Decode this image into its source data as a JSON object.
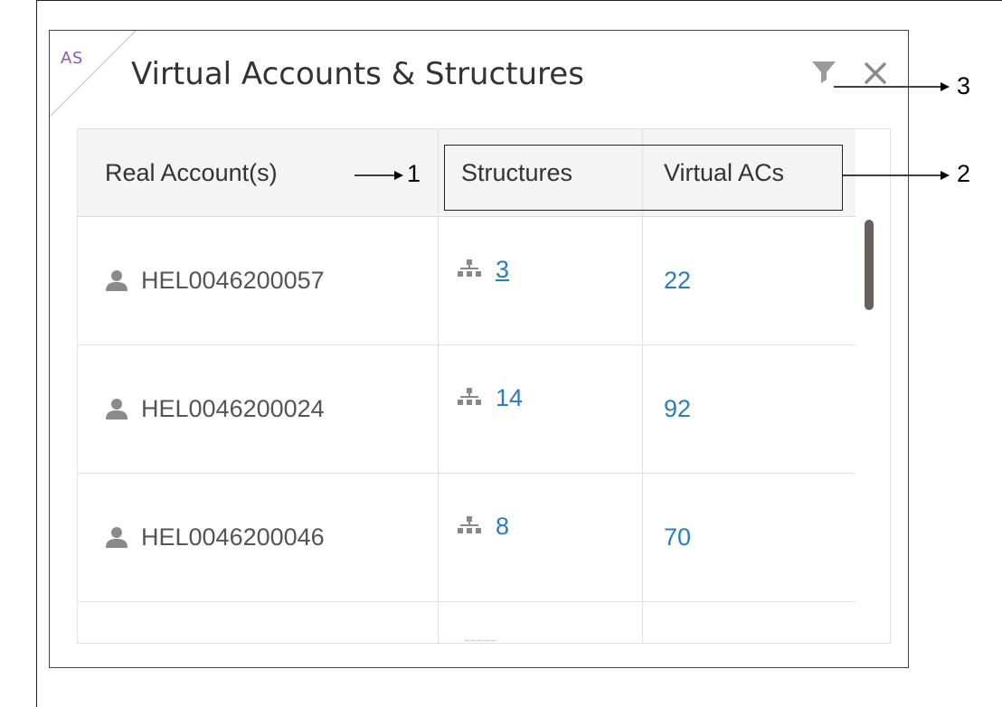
{
  "widget": {
    "tag": "AS",
    "title": "Virtual Accounts & Structures",
    "filter_icon": "filter-icon",
    "close_icon": "close-icon"
  },
  "table": {
    "headers": [
      "Real Account(s)",
      "Structures",
      "Virtual ACs"
    ],
    "rows": [
      {
        "account": "HEL0046200057",
        "structures": "3",
        "virtual_acs": "22"
      },
      {
        "account": "HEL0046200024",
        "structures": "14",
        "virtual_acs": "92"
      },
      {
        "account": "HEL0046200046",
        "structures": "8",
        "virtual_acs": "70"
      }
    ]
  },
  "annotations": {
    "callout_1": "1",
    "callout_2": "2",
    "callout_3": "3"
  },
  "colors": {
    "link": "#2a7cc0",
    "tag": "#8a55c7",
    "header_bg": "#f4f4f4"
  }
}
